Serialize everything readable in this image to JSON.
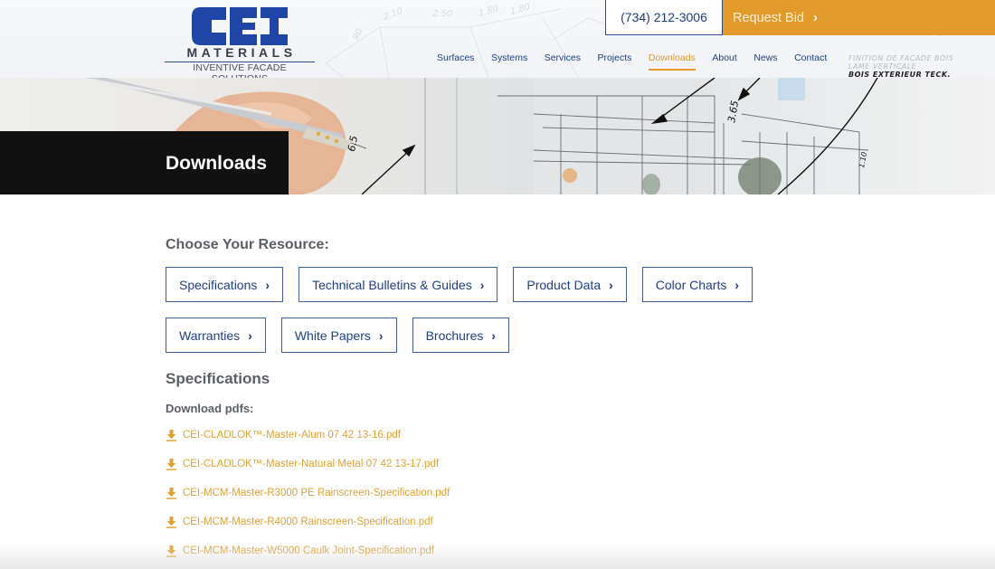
{
  "header": {
    "logo": {
      "mark": "CEI",
      "name": "MATERIALS",
      "tagline": "INVENTIVE FACADE SOLUTIONS"
    },
    "phone": "(734) 212-3006",
    "request_bid": "Request Bid",
    "nav": [
      {
        "label": "Surfaces",
        "active": false
      },
      {
        "label": "Systems",
        "active": false
      },
      {
        "label": "Services",
        "active": false
      },
      {
        "label": "Projects",
        "active": false
      },
      {
        "label": "Downloads",
        "active": true
      },
      {
        "label": "About",
        "active": false
      },
      {
        "label": "News",
        "active": false
      },
      {
        "label": "Contact",
        "active": false
      }
    ],
    "sketch_notes": [
      "FINITION DE FACADE BOIS",
      "LAME VERTICALE",
      "BOIS EXTERIEUR TECK."
    ]
  },
  "hero": {
    "title": "Downloads",
    "sketch_dims": [
      "6.5",
      "3.65",
      "1.10",
      "2.10",
      "2.50",
      "1.80",
      "1.80",
      "90"
    ]
  },
  "content": {
    "choose_label": "Choose Your Resource:",
    "resources_row1": [
      "Specifications",
      "Technical Bulletins & Guides",
      "Product Data",
      "Color Charts"
    ],
    "resources_row2": [
      "Warranties",
      "White Papers",
      "Brochures"
    ],
    "section_heading": "Specifications",
    "download_label": "Download pdfs:",
    "files": [
      "CEI-CLADLOK™-Master-Alum 07 42 13-16.pdf",
      "CEI-CLADLOK™-Master-Natural Metal 07 42 13-17.pdf",
      "CEI-MCM-Master-R3000 PE Rainscreen-Specification.pdf",
      "CEI-MCM-Master-R4000 Rainscreen-Specification.pdf",
      "CEI-MCM-Master-W5000 Caulk Joint-Specification.pdf"
    ]
  },
  "icons": {
    "chevron": "chevron-right-icon",
    "download": "download-icon"
  },
  "colors": {
    "brand_blue": "#1f3f86",
    "accent_orange": "#e29a2c",
    "link_orange": "#e0a237",
    "heading_gray": "#5c5f66",
    "title_block": "#111111"
  }
}
